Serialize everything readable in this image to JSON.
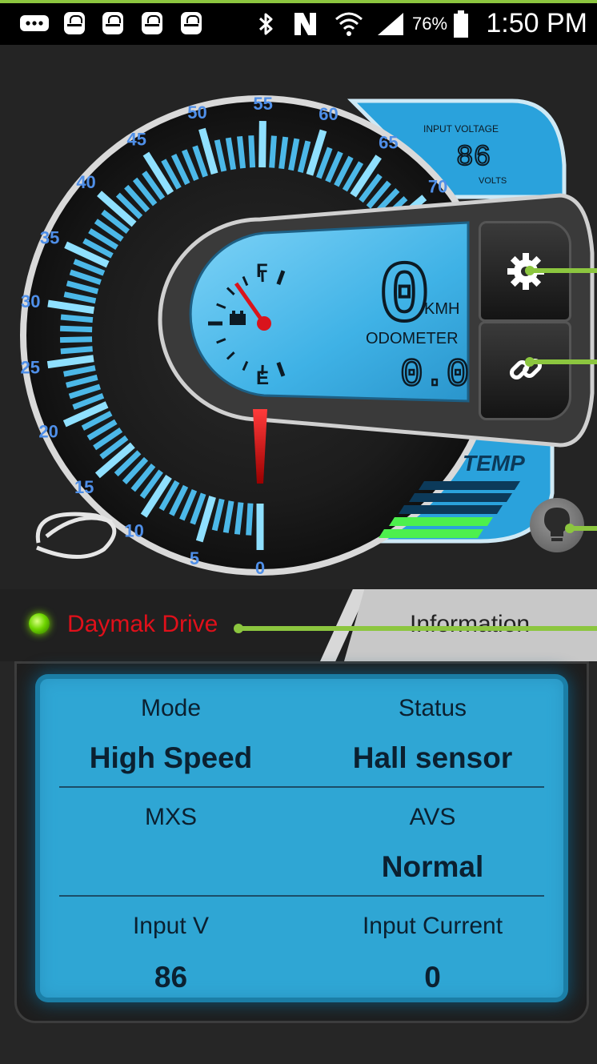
{
  "status_bar": {
    "time": "1:50 PM",
    "battery_percent": "76%",
    "icons": [
      "message-icon",
      "galaxy-icon",
      "galaxy-icon",
      "galaxy-icon",
      "galaxy-icon",
      "bluetooth-icon",
      "nfc-icon",
      "wifi-icon",
      "signal-icon",
      "battery-icon"
    ]
  },
  "dashboard": {
    "speedometer_ticks": [
      "0",
      "5",
      "10",
      "15",
      "20",
      "25",
      "30",
      "35",
      "40",
      "45",
      "50",
      "55",
      "60",
      "65",
      "70"
    ],
    "speed": "0",
    "speed_unit": "KMH",
    "odometer_label": "ODOMETER",
    "odometer_value": "0.0",
    "fuel_full": "F",
    "fuel_empty": "E",
    "input_voltage_label": "INPUT VOLTAGE",
    "input_voltage_value": "86",
    "input_voltage_unit": "VOLTS",
    "temp_label": "TEMP",
    "temp_level": 0.25,
    "buttons": [
      "gear-icon",
      "link-icon",
      "lightbulb-icon"
    ]
  },
  "tabs": {
    "connection_name": "Daymak Drive",
    "info_tab_label": "Information"
  },
  "info": {
    "mode_label": "Mode",
    "mode_value": "High Speed",
    "status_label": "Status",
    "status_value": "Hall sensor",
    "mxs_label": "MXS",
    "mxs_value": "",
    "avs_label": "AVS",
    "avs_value": "Normal",
    "input_v_label": "Input V",
    "input_v_value": "86",
    "input_current_label": "Input Current",
    "input_current_value": "0"
  },
  "colors": {
    "accent_green": "#8cc63f",
    "lcd_blue": "#3fb2e6",
    "drive_red": "#e0101a",
    "needle_red": "#e02020"
  }
}
